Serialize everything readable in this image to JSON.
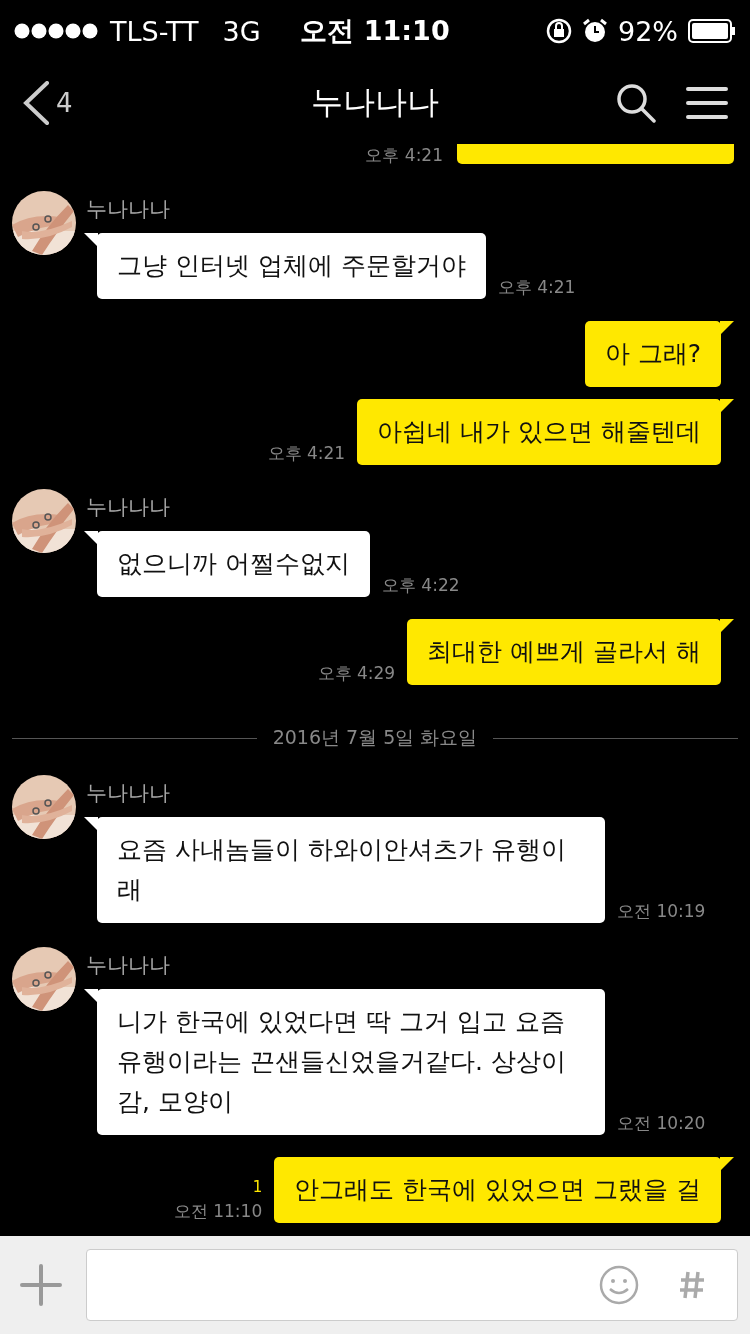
{
  "status_bar": {
    "carrier": "TLS-TT",
    "network": "3G",
    "time": "오전 11:10",
    "battery": "92%"
  },
  "header": {
    "back_count": "4",
    "title": "누나나나"
  },
  "messages": [
    {
      "kind": "clipped",
      "time": "오후 4:21"
    },
    {
      "kind": "incoming",
      "sender": "누나나나",
      "text": "그냥 인터넷 업체에 주문할거야",
      "time": "오후 4:21"
    },
    {
      "kind": "outgoing",
      "text": "아 그래?"
    },
    {
      "kind": "outgoing",
      "text": "아쉽네 내가 있으면 해줄텐데",
      "time": "오후 4:21"
    },
    {
      "kind": "incoming",
      "sender": "누나나나",
      "text": "없으니까 어쩔수없지",
      "time": "오후 4:22"
    },
    {
      "kind": "outgoing",
      "text": "최대한 예쁘게 골라서 해",
      "time": "오후 4:29"
    },
    {
      "kind": "date",
      "text": "2016년 7월 5일 화요일"
    },
    {
      "kind": "incoming",
      "sender": "누나나나",
      "text": "요즘 사내놈들이 하와이안셔츠가 유행이래",
      "time": "오전 10:19"
    },
    {
      "kind": "incoming",
      "sender": "누나나나",
      "text": "니가 한국에 있었다면 딱 그거 입고 요즘 유행이라는 끈샌들신었을거같다. 상상이 감, 모양이",
      "time": "오전 10:20"
    },
    {
      "kind": "outgoing",
      "text": "안그래도 한국에 있었으면 그랬을 걸",
      "time": "오전 11:10",
      "unread": "1"
    }
  ]
}
